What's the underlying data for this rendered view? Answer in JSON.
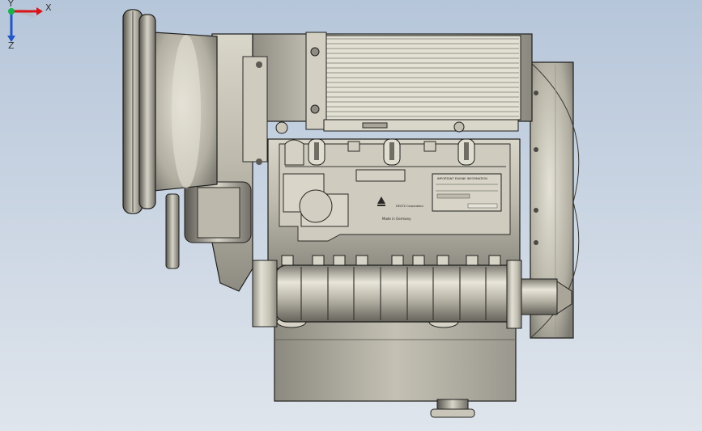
{
  "view": {
    "model_labels": {
      "plate_title": "IMPORTANT ENGINE INFORMATION",
      "brand": "DEUTZ Corporation",
      "origin": "Made in Germany"
    },
    "triad": {
      "x_label": "X",
      "y_label": "Y",
      "z_label": "Z"
    }
  },
  "colors": {
    "background_top": "#b6c6da",
    "background_bottom": "#dfe5ec",
    "metal_light": "#e6e3d7",
    "metal_mid": "#b9b6a8",
    "metal_dark": "#6f6d64",
    "edge": "#1e1e1c",
    "axis_x": "#d8141a",
    "axis_y": "#19b34a",
    "axis_z": "#2356c8"
  }
}
